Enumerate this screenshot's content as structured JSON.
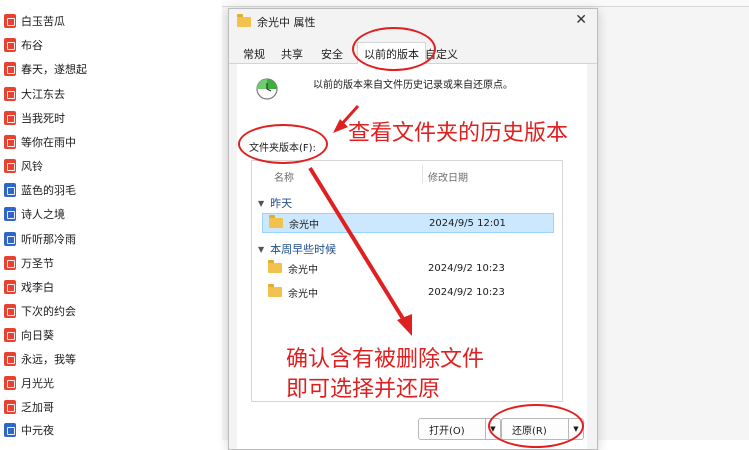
{
  "files": [
    {
      "name": "白玉苦瓜",
      "type": "pdf"
    },
    {
      "name": "布谷",
      "type": "pdf"
    },
    {
      "name": "春天，遂想起",
      "type": "pdf"
    },
    {
      "name": "大江东去",
      "type": "pdf"
    },
    {
      "name": "当我死时",
      "type": "pdf"
    },
    {
      "name": "等你在雨中",
      "type": "pdf"
    },
    {
      "name": "风铃",
      "type": "pdf"
    },
    {
      "name": "蓝色的羽毛",
      "type": "word"
    },
    {
      "name": "诗人之境",
      "type": "word"
    },
    {
      "name": "听听那冷雨",
      "type": "word"
    },
    {
      "name": "万圣节",
      "type": "pdf"
    },
    {
      "name": "戏李白",
      "type": "pdf"
    },
    {
      "name": "下次的约会",
      "type": "pdf"
    },
    {
      "name": "向日葵",
      "type": "pdf"
    },
    {
      "name": "永远，我等",
      "type": "pdf"
    },
    {
      "name": "月光光",
      "type": "pdf"
    },
    {
      "name": "乏加哥",
      "type": "pdf"
    },
    {
      "name": "中元夜",
      "type": "word"
    }
  ],
  "dialog": {
    "title": "余光中 属性",
    "close": "✕",
    "tabs": [
      "常规",
      "共享",
      "安全",
      "以前的版本",
      "自定义"
    ],
    "active_tab": "以前的版本",
    "description": "以前的版本来自文件历史记录或来自还原点。",
    "section_label": "文件夹版本(F):",
    "columns": {
      "name": "名称",
      "date": "修改日期"
    },
    "groups": [
      {
        "label": "昨天",
        "rows": [
          {
            "name": "余光中",
            "date": "2024/9/5 12:01",
            "selected": true
          }
        ]
      },
      {
        "label": "本周早些时候",
        "rows": [
          {
            "name": "余光中",
            "date": "2024/9/2 10:23",
            "selected": false
          },
          {
            "name": "余光中",
            "date": "2024/9/2 10:23",
            "selected": false
          }
        ]
      }
    ],
    "buttons": {
      "open": "打开(O)",
      "restore": "还原(R)"
    }
  },
  "annotations": {
    "note1": "查看文件夹的历史版本",
    "note2_line1": "确认含有被删除文件",
    "note2_line2": "即可选择并还原",
    "color": "#e02020"
  },
  "icons": {
    "chevron": "▼",
    "caret": "▼"
  }
}
